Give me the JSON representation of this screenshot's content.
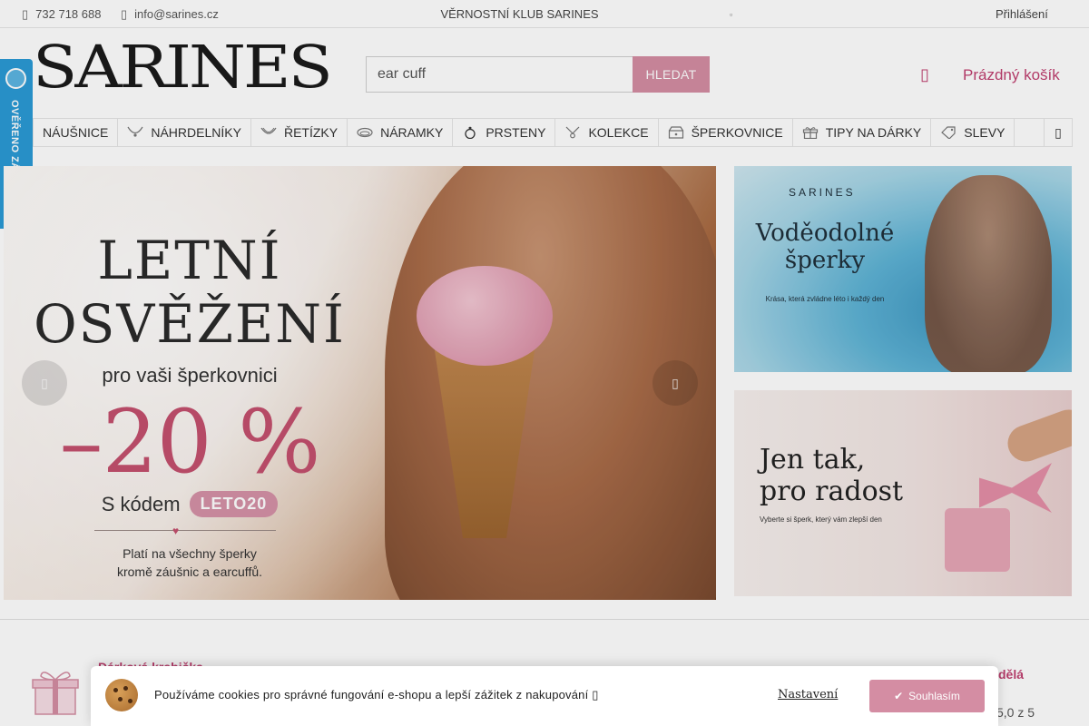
{
  "topbar": {
    "phone": "732 718 688",
    "email": "info@sarines.cz",
    "club": "VĚRNOSTNÍ KLUB SARINES",
    "login": "Přihlášení"
  },
  "header": {
    "logo": "SARINES",
    "search_value": "ear cuff",
    "search_button": "HLEDAT",
    "cart_label": "Prázdný košík"
  },
  "badge": {
    "text": "OVĚŘENO ZÁKAZNÍKY"
  },
  "nav": {
    "items": [
      {
        "label": "NÁUŠNICE",
        "icon": "earring-icon"
      },
      {
        "label": "NÁHRDELNÍKY",
        "icon": "necklace-icon"
      },
      {
        "label": "ŘETÍZKY",
        "icon": "chain-icon"
      },
      {
        "label": "NÁRAMKY",
        "icon": "bracelet-icon"
      },
      {
        "label": "PRSTENY",
        "icon": "ring-icon"
      },
      {
        "label": "KOLEKCE",
        "icon": "pendant-icon"
      },
      {
        "label": "ŠPERKOVNICE",
        "icon": "jewelry-box-icon"
      },
      {
        "label": "TIPY NA DÁRKY",
        "icon": "gift-icon"
      },
      {
        "label": "SLEVY",
        "icon": "tag-icon"
      }
    ]
  },
  "hero": {
    "line1": "LETNÍ",
    "line2": "OSVĚŽENÍ",
    "line3": "pro vaši šperkovnici",
    "discount": "–20 %",
    "code_prefix": "S kódem",
    "code": "LETO20",
    "note_line1": "Platí na všechny šperky",
    "note_line2": "kromě záušnic a earcuffů."
  },
  "banner1": {
    "brand": "SARINES",
    "title_line1": "Voděodolné",
    "title_line2": "šperky",
    "subtitle": "Krása, která zvládne léto i každý den"
  },
  "banner2": {
    "title_line1": "Jen tak,",
    "title_line2": "pro radost",
    "subtitle": "Vyberte si šperk, který vám zlepší den"
  },
  "benefits": {
    "gift_title": "Dárková krabička",
    "rating_title": "dělá",
    "rating_value": "5,0 z 5"
  },
  "cookie": {
    "text": "Používáme cookies pro správné fungování e-shopu a lepší zážitek z nakupování",
    "settings": "Nastavení",
    "agree": "Souhlasím"
  },
  "colors": {
    "accent": "#d48da3",
    "brand_pink": "#c04070",
    "badge_blue": "#2a9ad6"
  }
}
